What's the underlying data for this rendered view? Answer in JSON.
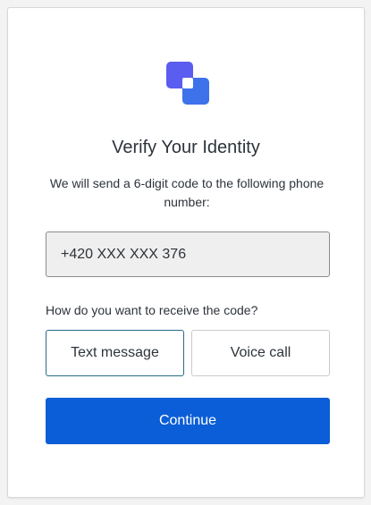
{
  "brand": {
    "logo_icon": "brand-logo-icon",
    "accent_color": "#4f5bd5"
  },
  "title": "Verify Your Identity",
  "description": "We will send a 6-digit code to the following phone number:",
  "phone": {
    "value": "+420 XXX XXX 376"
  },
  "question": "How do you want to receive the code?",
  "options": {
    "text_message": "Text message",
    "voice_call": "Voice call",
    "selected": "Text message"
  },
  "continue_label": "Continue",
  "colors": {
    "primary_button": "#0b5ed7",
    "selected_border": "#2a6b8a"
  }
}
